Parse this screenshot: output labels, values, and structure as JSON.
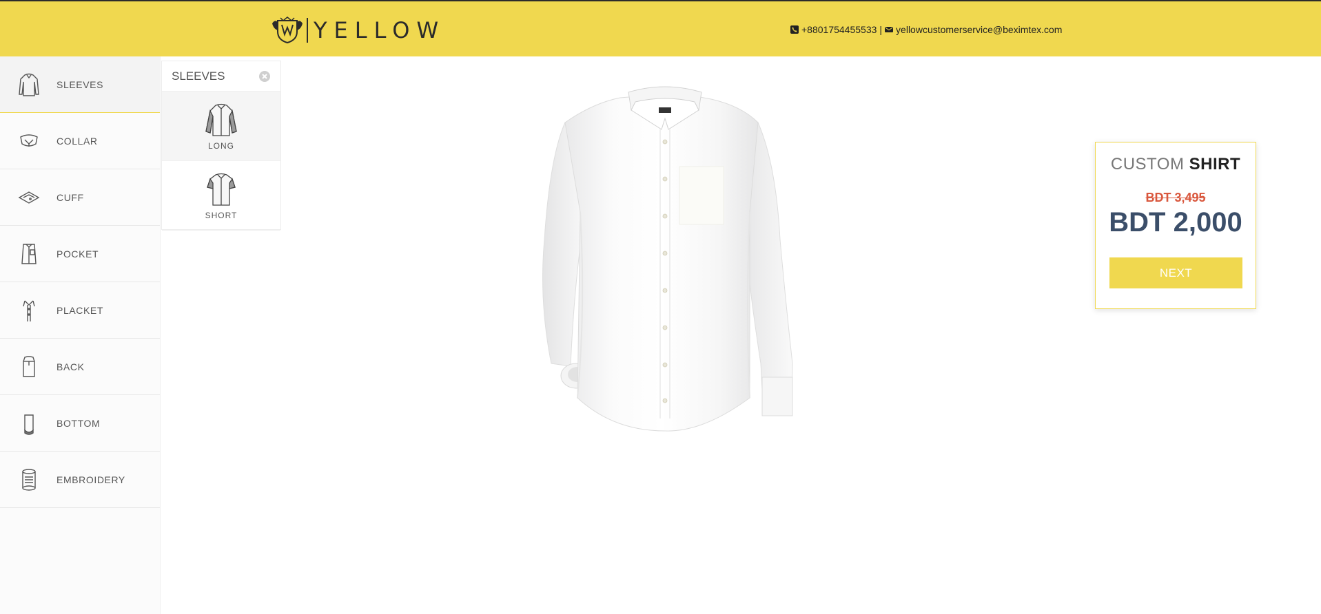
{
  "brand": {
    "name": "YELLOW"
  },
  "contact": {
    "phone": "+8801754455533",
    "separator": "|",
    "email": "yellowcustomerservice@beximtex.com"
  },
  "sidebar": {
    "items": [
      {
        "label": "SLEEVES",
        "icon": "sleeves-icon"
      },
      {
        "label": "COLLAR",
        "icon": "collar-icon"
      },
      {
        "label": "CUFF",
        "icon": "cuff-icon"
      },
      {
        "label": "POCKET",
        "icon": "pocket-icon"
      },
      {
        "label": "PLACKET",
        "icon": "placket-icon"
      },
      {
        "label": "BACK",
        "icon": "back-icon"
      },
      {
        "label": "BOTTOM",
        "icon": "bottom-icon"
      },
      {
        "label": "EMBROIDERY",
        "icon": "embroidery-icon"
      }
    ],
    "active_index": 0
  },
  "panel": {
    "title": "SLEEVES",
    "options": [
      {
        "label": "LONG",
        "selected": true
      },
      {
        "label": "SHORT",
        "selected": false
      }
    ]
  },
  "card": {
    "title_light": "CUSTOM",
    "title_bold": "SHIRT",
    "old_price": "BDT 3,495",
    "new_price": "BDT 2,000",
    "next_label": "NEXT"
  },
  "colors": {
    "accent": "#f0d84f",
    "price": "#3b4e69",
    "old_price": "#d9573d"
  }
}
